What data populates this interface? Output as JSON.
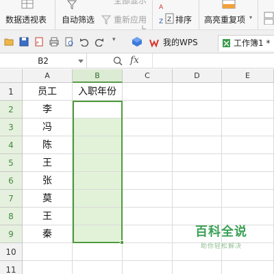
{
  "ribbon": {
    "pivot_label": "数据透视表",
    "autofilter_label": "自动筛选",
    "reapply_label": "重新应用",
    "sort_label": "排序",
    "highlight_dup_label": "高亮重复项",
    "showall_label": "全部显示"
  },
  "toolbar": {
    "tabs": [
      {
        "label": "我的WPS"
      },
      {
        "label": "工作簿1 *"
      }
    ]
  },
  "formula_bar": {
    "cell_ref": "B2",
    "fx_label": "fx",
    "value": ""
  },
  "sheet": {
    "columns": [
      "A",
      "B",
      "C",
      "D",
      "E"
    ],
    "rows": [
      "1",
      "2",
      "3",
      "4",
      "5",
      "6",
      "7",
      "8",
      "9",
      "10",
      "11"
    ],
    "header_row": {
      "A": "员工",
      "B": "入职年份"
    },
    "employees": [
      "李",
      "冯",
      "陈",
      "王",
      "张",
      "莫",
      "王",
      "秦"
    ],
    "selection": "B2:B9"
  },
  "watermark": {
    "title": "百科全说",
    "subtitle": "助你轻松解决"
  },
  "colors": {
    "selection_border": "#4e9a3e",
    "selection_fill": "#e2f2d8",
    "wps_red": "#d9352b",
    "watermark_green": "#3aa055"
  }
}
